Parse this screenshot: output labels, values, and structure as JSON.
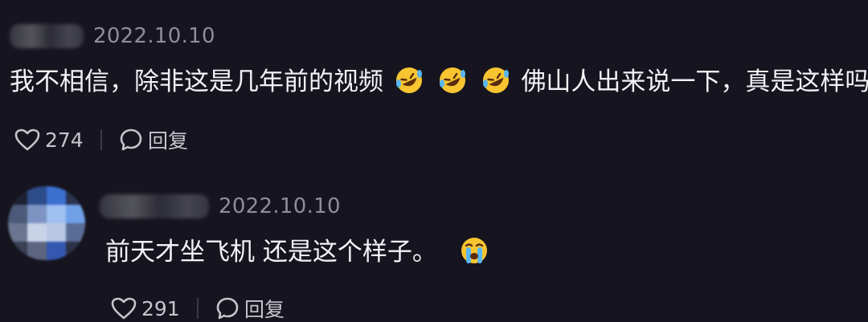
{
  "comments": [
    {
      "date": "2022.10.10",
      "text_part1": "我不相信，除非这是几年前的视频",
      "emojis": [
        "rofl-emoji",
        "rofl-emoji",
        "rofl-emoji"
      ],
      "text_part2": "佛山人出来说一下，真是这样吗",
      "likes": "274",
      "reply_label": "回复"
    },
    {
      "date": "2022.10.10",
      "text": "前天才坐飞机 还是这个样子。",
      "emojis": [
        "crying-emoji"
      ],
      "likes": "291",
      "reply_label": "回复"
    }
  ],
  "colors": {
    "background": "#16151f",
    "text": "#f2f1f6",
    "muted": "#8f8e98",
    "action": "#c5c4cc"
  }
}
